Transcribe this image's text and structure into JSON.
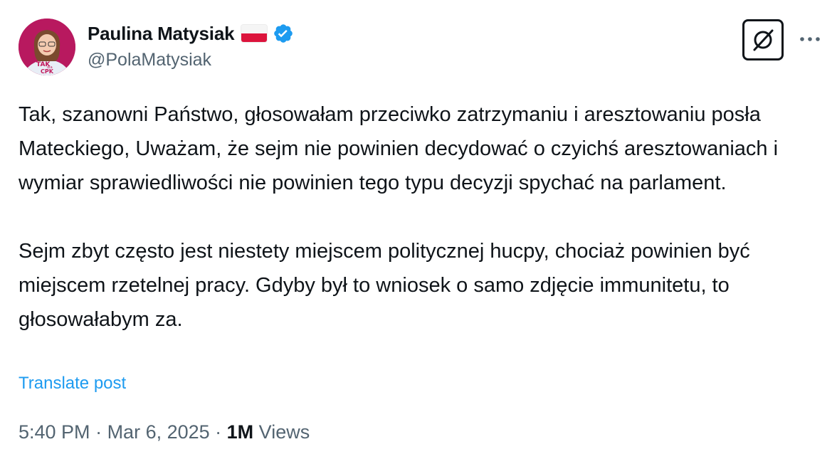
{
  "author": {
    "display_name": "Paulina Matysiak",
    "handle": "@PolaMatysiak",
    "avatar_text": "TAK dla CPK",
    "flag": "poland-flag",
    "verified": true,
    "verified_color": "#1d9bf0"
  },
  "toolbar": {
    "grok_icon": "grok-icon",
    "more_icon": "more-icon"
  },
  "tweet": {
    "paragraphs": [
      "Tak, szanowni Państwo, głosowałam przeciwko zatrzymaniu i aresztowaniu posła Mateckiego, Uważam, że sejm nie powinien decydować o czyichś aresztowaniach i wymiar sprawiedliwości nie powinien tego typu decyzji spychać na parlament.",
      "Sejm zbyt często jest niestety miejscem politycznej hucpy, chociaż powinien być miejscem rzetelnej pracy. Gdyby był to wniosek o samo zdjęcie immunitetu, to głosowałabym za."
    ],
    "translate_label": "Translate post"
  },
  "meta": {
    "time": "5:40 PM",
    "separator": " · ",
    "date": "Mar 6, 2025",
    "views_count": "1M",
    "views_label": " Views"
  },
  "colors": {
    "text": "#0f1419",
    "secondary": "#536471",
    "link": "#1d9bf0"
  }
}
